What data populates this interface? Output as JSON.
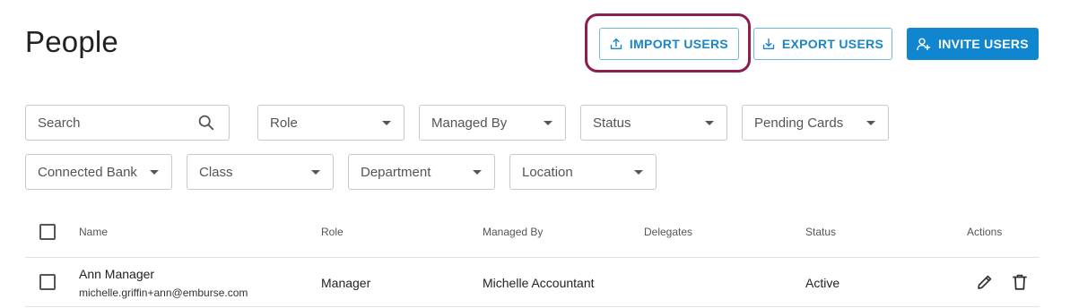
{
  "page": {
    "title": "People"
  },
  "toolbar": {
    "import_label": "IMPORT USERS",
    "export_label": "EXPORT USERS",
    "invite_label": "INVITE USERS",
    "accent_color": "#0f86cf",
    "highlight_color": "#8c1d4e"
  },
  "filters": {
    "search_placeholder": "Search",
    "role": "Role",
    "managed_by": "Managed By",
    "status": "Status",
    "pending_cards": "Pending Cards",
    "connected_bank": "Connected Bank",
    "class": "Class",
    "department": "Department",
    "location": "Location"
  },
  "table": {
    "columns": {
      "name": "Name",
      "role": "Role",
      "managed_by": "Managed By",
      "delegates": "Delegates",
      "status": "Status",
      "actions": "Actions"
    },
    "rows": [
      {
        "name": "Ann Manager",
        "email": "michelle.griffin+ann@emburse.com",
        "role": "Manager",
        "managed_by": "Michelle Accountant",
        "delegates": "",
        "status": "Active",
        "action_icons": [
          "pencil-icon",
          "trash-icon"
        ]
      }
    ]
  }
}
